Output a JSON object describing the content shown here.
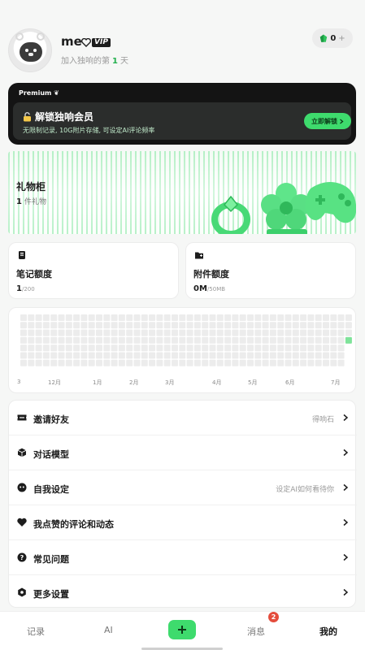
{
  "profile": {
    "username": "me",
    "vip_label": "VIP",
    "join_prefix": "加入独响的第",
    "join_days": "1",
    "join_suffix": "天",
    "coins": "0",
    "coins_plus": "+"
  },
  "premium": {
    "tag": "Premium",
    "title": "解锁独响会员",
    "subtitle": "无限制记录, 10G附片存储, 可设定AI评论频率",
    "button": "立即解锁",
    "accent": "#3edb6d"
  },
  "gift": {
    "title": "礼物柜",
    "count": "1",
    "count_unit": "件礼物"
  },
  "quota": [
    {
      "title": "笔记额度",
      "value": "1",
      "limit": "/200",
      "icon": "note-icon"
    },
    {
      "title": "附件额度",
      "value": "0M",
      "limit": "/50MB",
      "icon": "folder-icon"
    }
  ],
  "heatmap": {
    "months": [
      "3",
      "12月",
      "1月",
      "2月",
      "3月",
      "4月",
      "5月",
      "6月",
      "7月"
    ],
    "active_color": "#7fe39a",
    "empty_color": "#ececec"
  },
  "menu": [
    {
      "label": "邀请好友",
      "hint": "得响石",
      "icon": "ticket-icon"
    },
    {
      "label": "对话模型",
      "hint": "",
      "icon": "cube-icon"
    },
    {
      "label": "自我设定",
      "hint": "设定AI如何看待你",
      "icon": "face-icon"
    },
    {
      "label": "我点赞的评论和动态",
      "hint": "",
      "icon": "heart-icon"
    },
    {
      "label": "常见问题",
      "hint": "",
      "icon": "question-icon"
    },
    {
      "label": "更多设置",
      "hint": "",
      "icon": "gear-icon"
    }
  ],
  "nav": {
    "items": [
      "记录",
      "AI",
      "消息",
      "我的"
    ],
    "badge": "2",
    "active": "我的"
  }
}
